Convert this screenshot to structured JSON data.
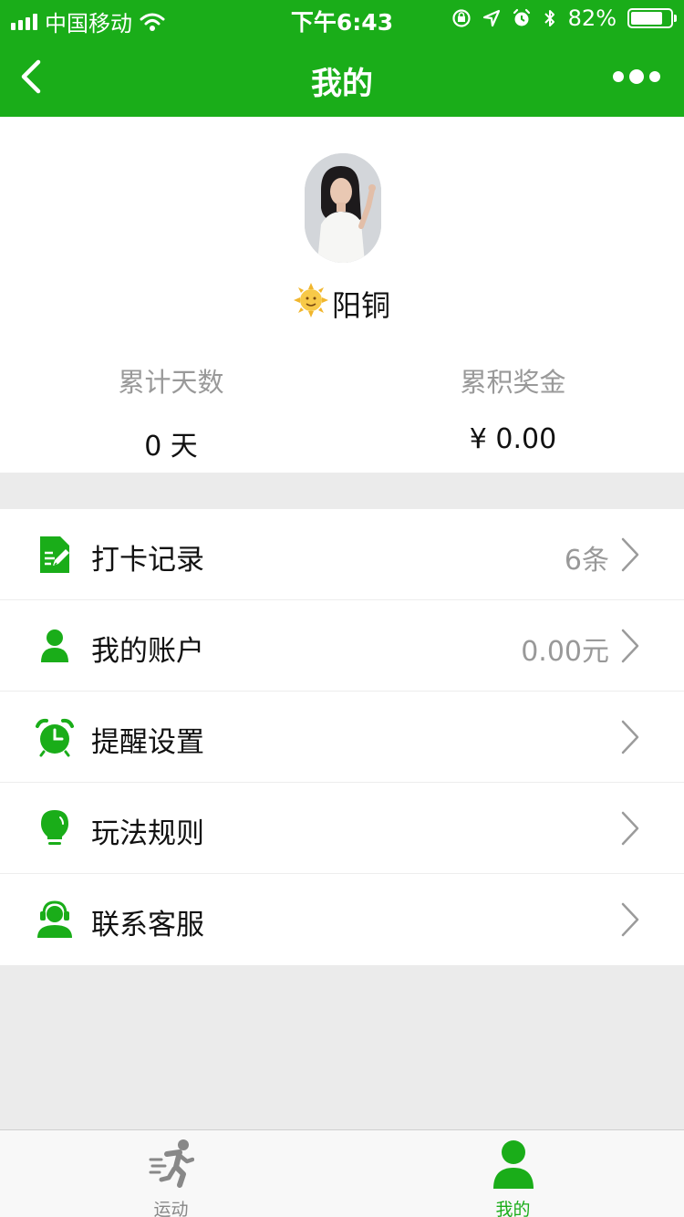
{
  "status_bar": {
    "carrier": "中国移动",
    "time": "下午6:43",
    "battery_text": "82%",
    "battery_level": 0.82
  },
  "nav": {
    "title": "我的",
    "back_icon": "chevron-left-icon",
    "more_icon": "more-dots-icon"
  },
  "profile": {
    "emoji": "🌞",
    "name": "阳铜"
  },
  "stats": [
    {
      "label": "累计天数",
      "value": "0 天"
    },
    {
      "label": "累积奖金",
      "value": "¥ 0.00"
    }
  ],
  "menu": [
    {
      "icon": "checkin-record-icon",
      "label": "打卡记录",
      "value": "6条"
    },
    {
      "icon": "user-account-icon",
      "label": "我的账户",
      "value": "0.00元"
    },
    {
      "icon": "alarm-clock-icon",
      "label": "提醒设置",
      "value": ""
    },
    {
      "icon": "lightbulb-icon",
      "label": "玩法规则",
      "value": ""
    },
    {
      "icon": "customer-service-icon",
      "label": "联系客服",
      "value": ""
    }
  ],
  "tabs": [
    {
      "icon": "running-icon",
      "label": "运动",
      "active": false
    },
    {
      "icon": "user-icon",
      "label": "我的",
      "active": true
    }
  ],
  "colors": {
    "brand_green": "#1aad19",
    "inactive_gray": "#888888",
    "value_gray": "#999999"
  }
}
